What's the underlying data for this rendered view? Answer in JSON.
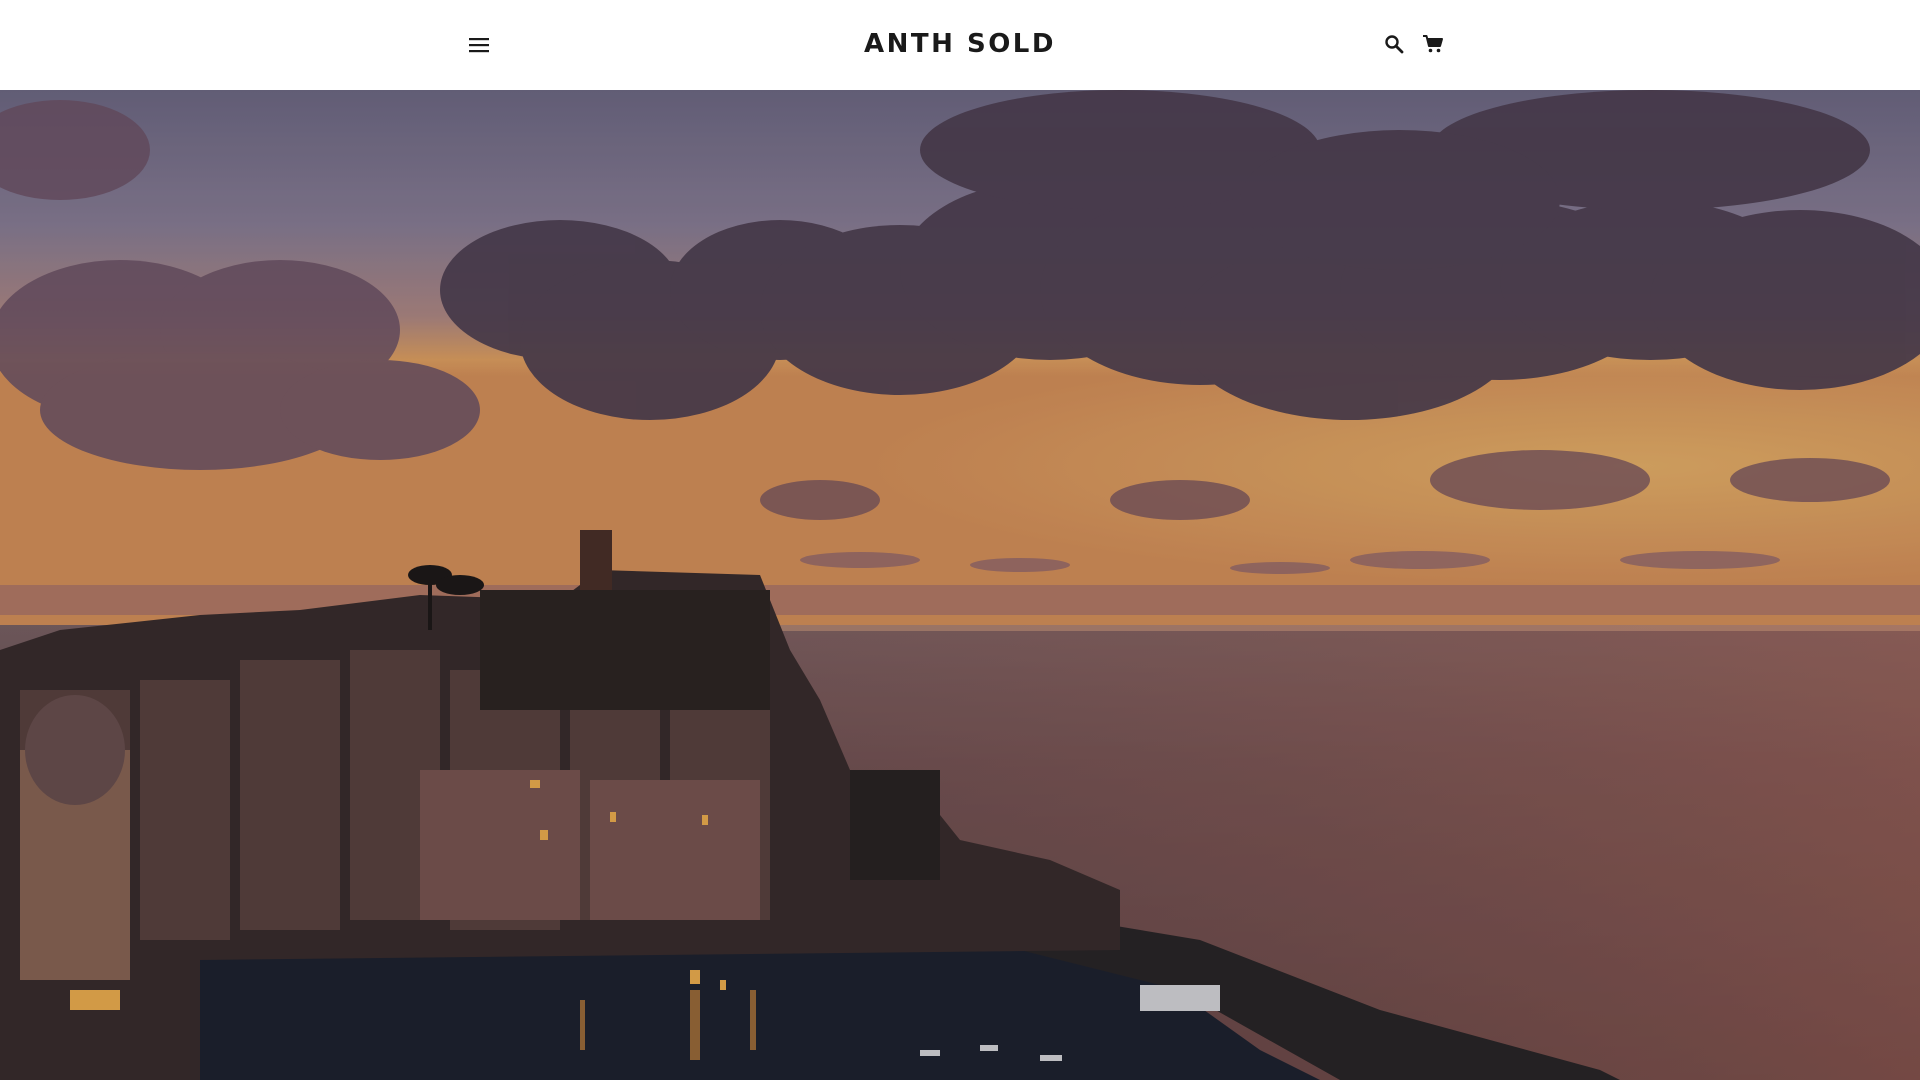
{
  "header": {
    "brand": "ANTH SOLD",
    "menu_icon": "hamburger-menu-icon",
    "search_icon": "search-icon",
    "cart_icon": "cart-icon",
    "background": "#ffffff",
    "text_color": "#1a1a1a"
  },
  "hero": {
    "image_subject": "coastal-village-sunset-photo",
    "colors": {
      "sky_top": "#7d7591",
      "sky_horizon": "#e8a05a",
      "sea": "#7a4a45",
      "clouds": "#5a4658",
      "town": "#3a2a2a"
    }
  }
}
